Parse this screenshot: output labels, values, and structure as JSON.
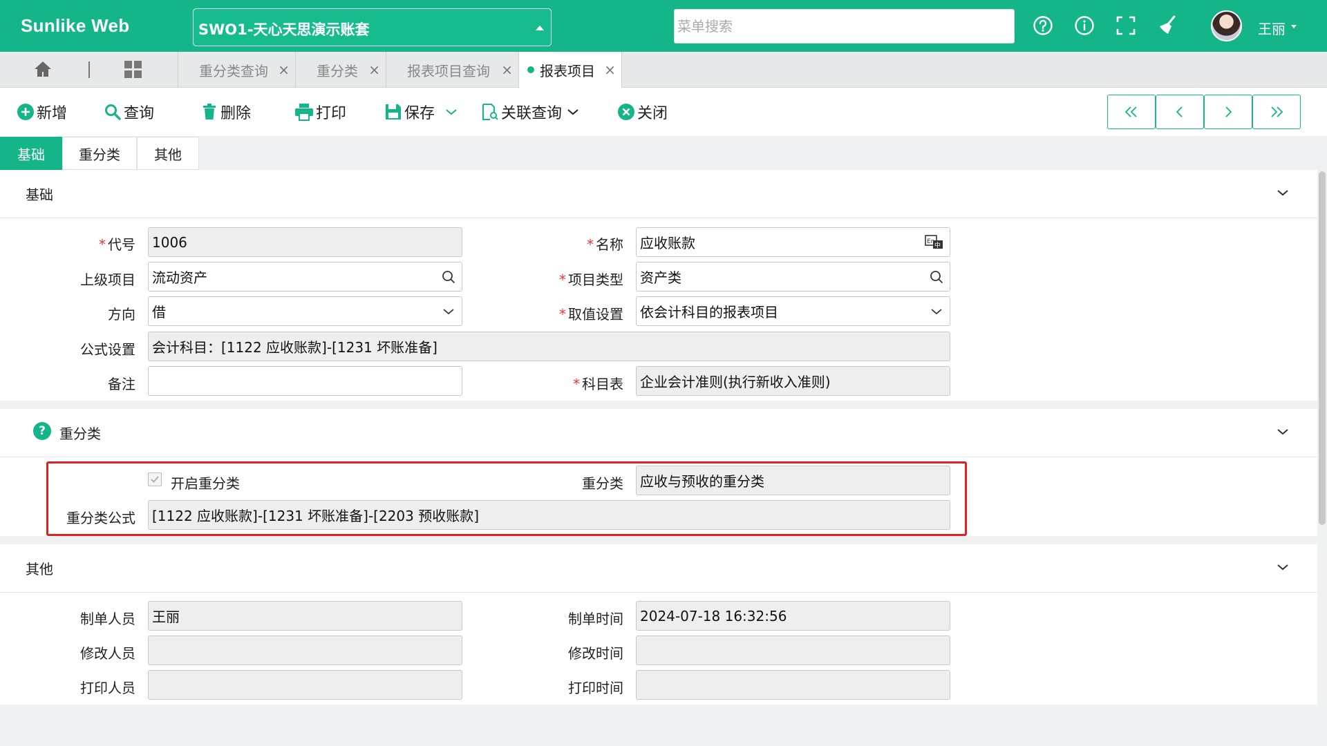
{
  "header": {
    "brand": "Sunlike Web",
    "account": "SWO1-天心天思演示账套",
    "search_placeholder": "菜单搜索",
    "username": "王丽"
  },
  "open_tabs": [
    {
      "label": "重分类查询"
    },
    {
      "label": "重分类"
    },
    {
      "label": "报表项目查询"
    },
    {
      "label": "报表项目",
      "active": true
    }
  ],
  "toolbar": {
    "add": "新增",
    "query": "查询",
    "delete": "删除",
    "print": "打印",
    "save": "保存",
    "related_query": "关联查询",
    "close": "关闭"
  },
  "form_tabs": [
    "基础",
    "重分类",
    "其他"
  ],
  "basic": {
    "title": "基础",
    "code_label": "代号",
    "code": "1006",
    "name_label": "名称",
    "name": "应收账款",
    "parent_label": "上级项目",
    "parent": "流动资产",
    "type_label": "项目类型",
    "type": "资产类",
    "direction_label": "方向",
    "direction": "借",
    "value_label": "取值设置",
    "value": "依会计科目的报表项目",
    "formula_label": "公式设置",
    "formula": "会计科目：[1122 应收账款]-[1231 坏账准备]",
    "remark_label": "备注",
    "remark": "",
    "chart_label": "科目表",
    "chart": "企业会计准则(执行新收入准则)"
  },
  "reclass": {
    "title": "重分类",
    "enable_label": "开启重分类",
    "reclass_label": "重分类",
    "reclass": "应收与预收的重分类",
    "formula_label": "重分类公式",
    "formula": "[1122 应收账款]-[1231 坏账准备]-[2203 预收账款]"
  },
  "other": {
    "title": "其他",
    "creator_label": "制单人员",
    "creator": "王丽",
    "created_label": "制单时间",
    "created": "2024-07-18 16:32:56",
    "modifier_label": "修改人员",
    "modifier": "",
    "modified_label": "修改时间",
    "modified": "",
    "printer_label": "打印人员",
    "printer": "",
    "printed_label": "打印时间",
    "printed": ""
  },
  "colors": {
    "accent": "#14b589",
    "required": "#e53935",
    "highlight": "#e02020"
  }
}
